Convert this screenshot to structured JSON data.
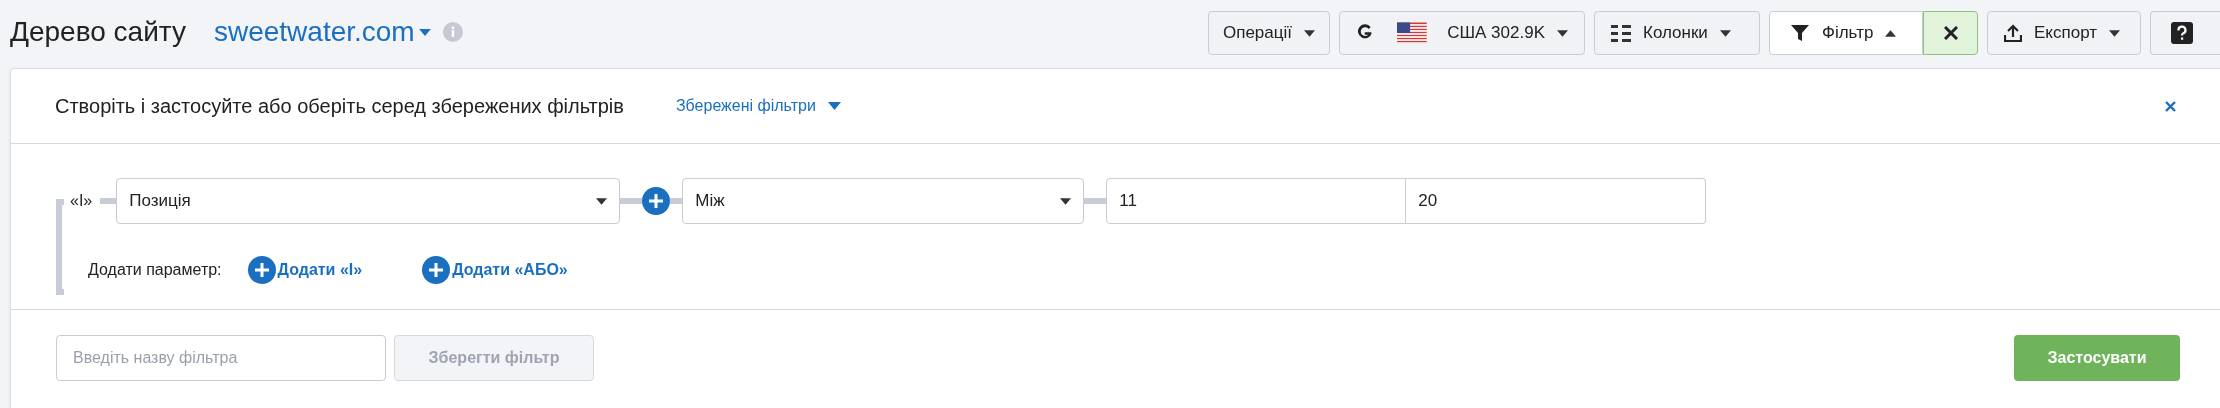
{
  "header": {
    "title": "Дерево сайту",
    "domain": "sweetwater.com"
  },
  "toolbar": [
    {
      "kind": "menu",
      "label": "Операції",
      "expanded": false
    },
    {
      "kind": "database",
      "label": "США 302.9K",
      "expanded": false
    },
    {
      "kind": "columns",
      "label": "Колонки",
      "expanded": false
    },
    {
      "kind": "filter",
      "label": "Фільтр",
      "expanded": true
    },
    {
      "kind": "export",
      "label": "Експорт",
      "expanded": false
    },
    {
      "kind": "help"
    }
  ],
  "filter_panel": {
    "heading": "Створіть і застосуйте або оберіть серед збережених фільтрів",
    "saved_filters": "Збережені фільтри",
    "condition": {
      "operator": "«І»",
      "field": "Позиція",
      "comparison": "Між",
      "from": "11",
      "to": "20"
    },
    "add_label": "Додати параметр:",
    "add_links": [
      "Додати «І»",
      "Додати «АБО»"
    ],
    "name_placeholder": "Введіть назву фільтра",
    "save": {
      "label": "Зберегти фільтр",
      "disabled": true
    },
    "apply": "Застосувати"
  }
}
